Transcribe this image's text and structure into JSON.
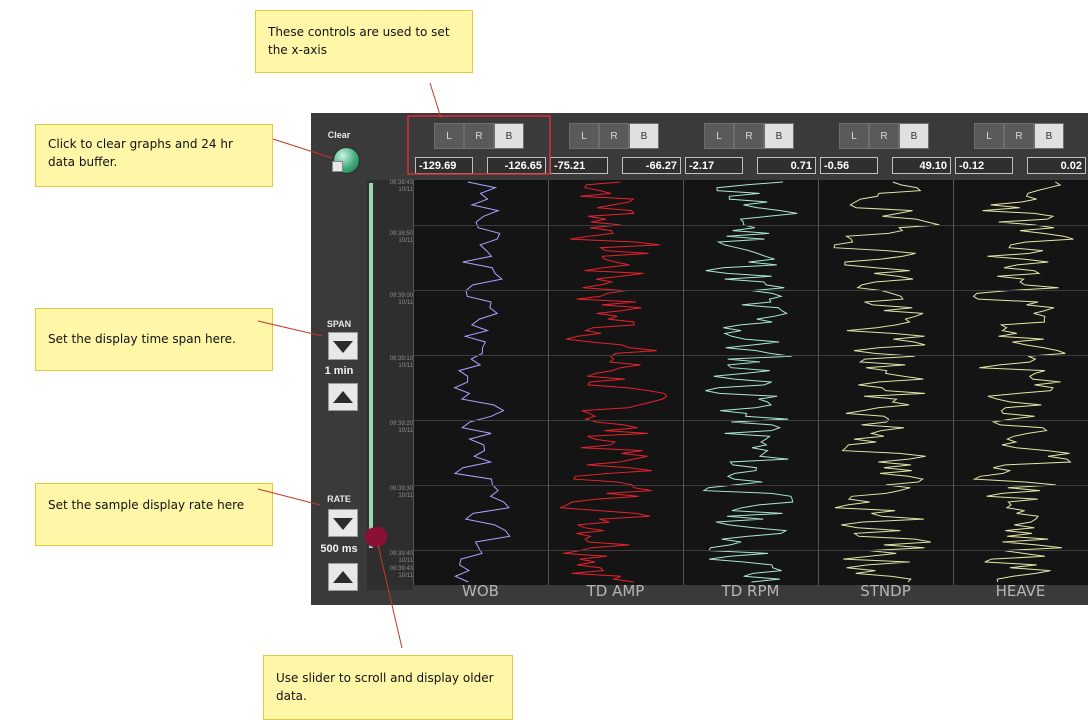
{
  "callouts": {
    "xaxis": "These controls are used to set the x-axis",
    "clear": "Click to clear graphs and 24 hr data buffer.",
    "span": "Set the display time span here.",
    "rate": "Set the sample display rate here",
    "slider": "Use slider to scroll and display older data."
  },
  "controls": {
    "clear_label": "Clear",
    "span_label": "SPAN",
    "span_value": "1 min",
    "rate_label": "RATE",
    "rate_value": "500 ms"
  },
  "lrb_labels": [
    "L",
    "R",
    "B"
  ],
  "tracks": [
    {
      "name": "WOB",
      "min": "-129.69",
      "max": "-126.65",
      "color": "#a8a4ff",
      "seed": 3
    },
    {
      "name": "TD AMP",
      "min": "-75.21",
      "max": "-66.27",
      "color": "#e5222e",
      "seed": 7
    },
    {
      "name": "TD RPM",
      "min": "-2.17",
      "max": "0.71",
      "color": "#a9e6d4",
      "seed": 11
    },
    {
      "name": "STNDP",
      "min": "-0.56",
      "max": "49.10",
      "color": "#dbe6a8",
      "seed": 19
    },
    {
      "name": "HEAVE",
      "min": "-0.12",
      "max": "0.02",
      "color": "#e4e6a8",
      "seed": 23
    }
  ],
  "time_labels": [
    {
      "time": "09:38:43",
      "date": "10/11"
    },
    {
      "time": "09:38:50",
      "date": "10/11"
    },
    {
      "time": "09:39:00",
      "date": "10/11"
    },
    {
      "time": "09:39:10",
      "date": "10/11"
    },
    {
      "time": "09:39:20",
      "date": "10/11"
    },
    {
      "time": "09:39:30",
      "date": "10/11"
    },
    {
      "time": "09:39:40",
      "date": "10/11"
    },
    {
      "time": "09:39:43",
      "date": "10/11"
    }
  ]
}
